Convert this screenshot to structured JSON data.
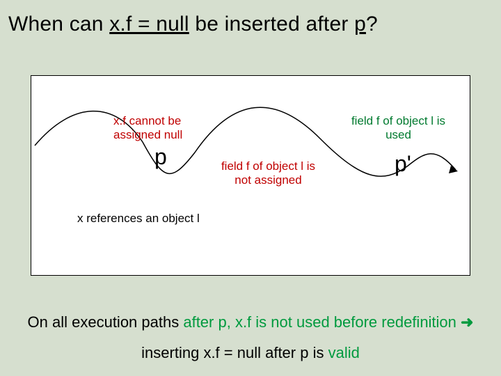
{
  "title": {
    "pre": "When can ",
    "code": "x.f = null",
    "mid": " be inserted after ",
    "p": "p",
    "q": "?"
  },
  "annotations": {
    "cannot": "x.f cannot be assigned null",
    "not_assigned": "field f of object l is not assigned",
    "used": "field f of object l is used",
    "references": "x references an object l"
  },
  "labels": {
    "p": "p",
    "pprime": "p'"
  },
  "bottom": {
    "l1_pre": "On all execution paths ",
    "l1_green": "after p, x.f is not used before redefinition",
    "l1_arrow": " ➜",
    "l2_pre": "inserting x.f = null after p is ",
    "l2_green": "valid"
  }
}
